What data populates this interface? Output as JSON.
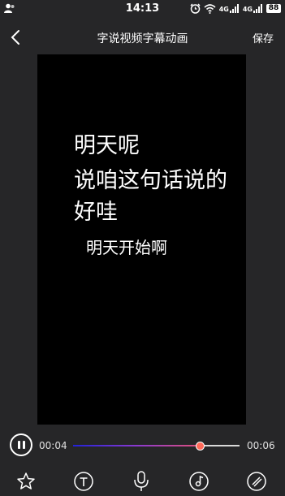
{
  "status_bar": {
    "time": "14:13",
    "signal_1_label": "4G",
    "signal_2_label": "4G",
    "battery": "88"
  },
  "header": {
    "title": "字说视频字幕动画",
    "save_label": "保存",
    "back_icon": "chevron-left-icon"
  },
  "preview": {
    "captions": [
      "明天呢",
      "说咱这句话说的好哇",
      "明天开始啊"
    ]
  },
  "player": {
    "current_time": "00:04",
    "total_time": "00:06",
    "progress": 0.76,
    "play_state": "playing"
  },
  "toolbar": {
    "tools": [
      "sticker-icon",
      "text-icon",
      "microphone-icon",
      "music-icon",
      "brush-icon"
    ]
  },
  "colors": {
    "background": "#262628",
    "preview": "#000000",
    "progress_start": "#2222d8",
    "progress_end": "#e0507a",
    "thumb": "#ff6a5a"
  }
}
